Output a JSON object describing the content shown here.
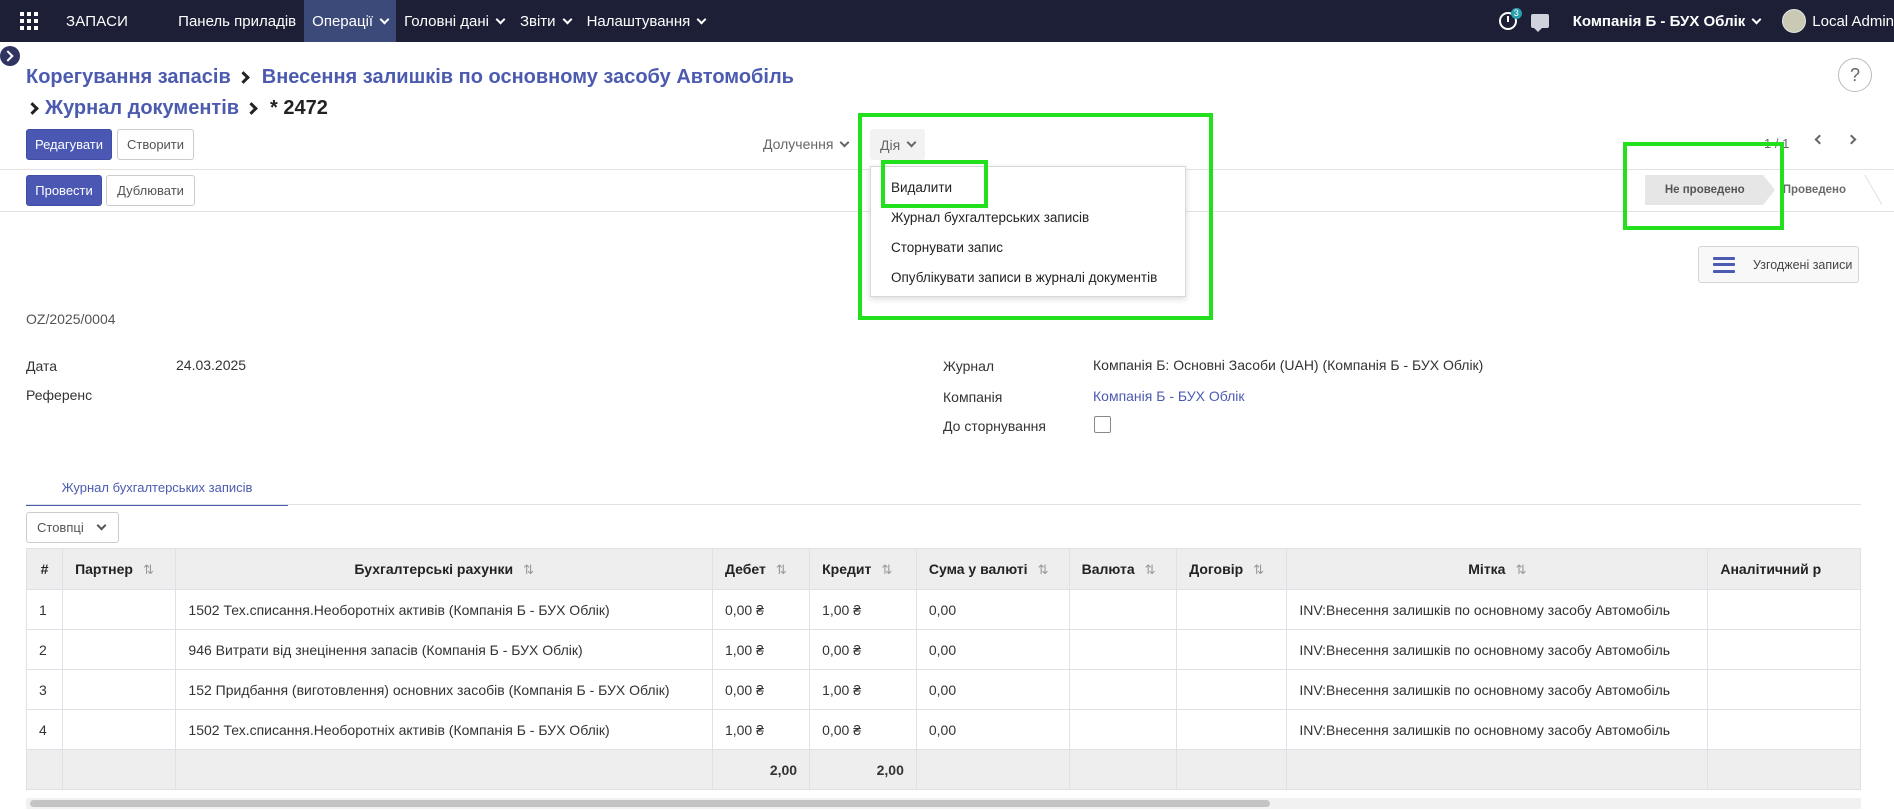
{
  "navbar": {
    "brand": "ЗАПАСИ",
    "menu": [
      {
        "label": "Панель приладів",
        "caret": false,
        "active": false
      },
      {
        "label": "Операції",
        "caret": true,
        "active": true
      },
      {
        "label": "Головні дані",
        "caret": true,
        "active": false
      },
      {
        "label": "Звіти",
        "caret": true,
        "active": false
      },
      {
        "label": "Налаштування",
        "caret": true,
        "active": false
      }
    ],
    "activity_count": "3",
    "company": "Компанія Б - БУХ Облік",
    "user": "Local Admin"
  },
  "breadcrumb": {
    "items": [
      "Корегування запасів",
      "Внесення залишків по основному засобу Автомобіль",
      "Журнал документів"
    ],
    "current": "* 2472"
  },
  "toolbar": {
    "edit": "Редагувати",
    "create": "Створити",
    "attachments": "Долучення",
    "action": "Дія",
    "pager": "1 / 1"
  },
  "action_menu": {
    "items": [
      "Видалити",
      "Журнал бухгалтерських записів",
      "Сторнувати запис",
      "Опублікувати записи в журналі документів"
    ]
  },
  "header_buttons": {
    "post": "Провести",
    "duplicate": "Дублювати"
  },
  "status": {
    "current": "Не проведено",
    "next": "Проведено"
  },
  "smart_button": "Узгоджені записи",
  "record": {
    "number": "OZ/2025/0004",
    "date_label": "Дата",
    "date": "24.03.2025",
    "ref_label": "Референс",
    "journal_label": "Журнал",
    "journal": "Компанія Б: Основні Засоби (UAH) (Компанія Б - БУХ Облік)",
    "company_label": "Компанія",
    "company": "Компанія Б - БУХ Облік",
    "reverse_label": "До сторнування"
  },
  "tab": "Журнал бухгалтерських записів",
  "columns_button": "Стовпці",
  "table": {
    "headers": [
      "#",
      "Партнер",
      "Бухгалтерські рахунки",
      "Дебет",
      "Кредит",
      "Сума у валюті",
      "Валюта",
      "Договір",
      "Мітка",
      "Аналітичний р"
    ],
    "rows": [
      [
        "1",
        "",
        "1502 Тех.списання.Необоротніх активів (Компанія Б - БУХ Облік)",
        "0,00 ₴",
        "1,00 ₴",
        "0,00",
        "",
        "",
        "INV:Внесення залишків по основному засобу Автомобіль",
        ""
      ],
      [
        "2",
        "",
        "946 Витрати від знецінення запасів (Компанія Б - БУХ Облік)",
        "1,00 ₴",
        "0,00 ₴",
        "0,00",
        "",
        "",
        "INV:Внесення залишків по основному засобу Автомобіль",
        ""
      ],
      [
        "3",
        "",
        "152 Придбання (виготовлення) основних засобів (Компанія Б - БУХ Облік)",
        "0,00 ₴",
        "1,00 ₴",
        "0,00",
        "",
        "",
        "INV:Внесення залишків по основному засобу Автомобіль",
        ""
      ],
      [
        "4",
        "",
        "1502 Тех.списання.Необоротніх активів (Компанія Б - БУХ Облік)",
        "1,00 ₴",
        "0,00 ₴",
        "0,00",
        "",
        "",
        "INV:Внесення залишків по основному засобу Автомобіль",
        ""
      ]
    ],
    "totals": {
      "debit": "2,00",
      "credit": "2,00"
    }
  }
}
